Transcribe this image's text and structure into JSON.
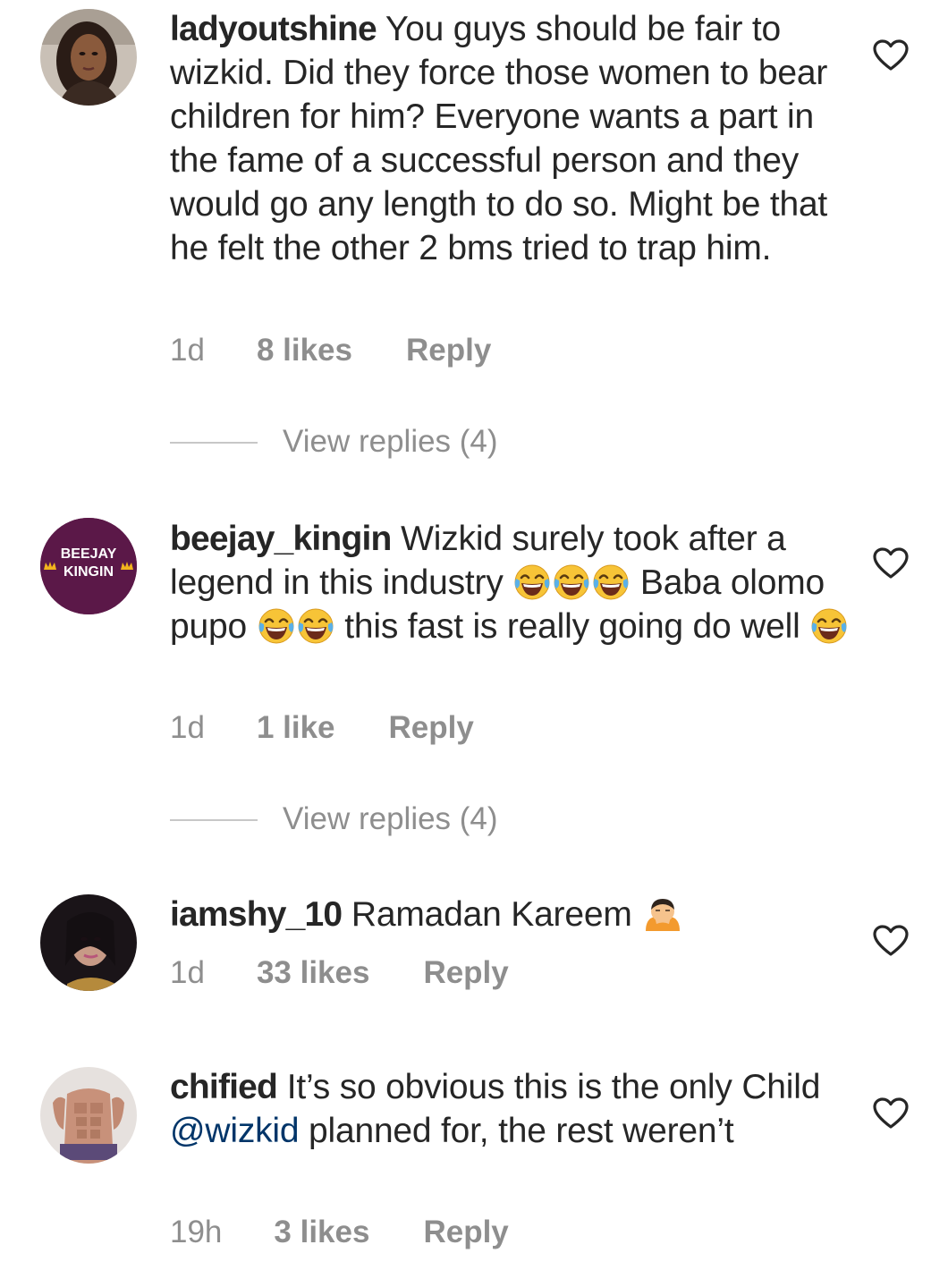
{
  "comments": [
    {
      "username": "ladyoutshine",
      "text": " You guys should be fair to wizkid. Did they force those women to bear children for him? Everyone wants a part in the fame of a successful person and they would go any length to do so. Might be that he felt the other 2 bms tried to trap him.",
      "time": "1d",
      "likes": "8 likes",
      "reply": "Reply",
      "view_replies": "View replies (4)",
      "like_icon": "heart-outline-icon"
    },
    {
      "username": "beejay_kingin",
      "text_1": " Wizkid surely took after a legend in this industry ",
      "emoji_1": "face-with-tears-of-joy",
      "text_2": " Baba olomo pupo ",
      "text_3": " this fast is really going do well ",
      "avatar_line1": "BEEJAY",
      "avatar_line2": "KINGIN",
      "time": "1d",
      "likes": "1 like",
      "reply": "Reply",
      "view_replies": "View replies (4)",
      "like_icon": "heart-outline-icon"
    },
    {
      "username": "iamshy_10",
      "text": " Ramadan Kareem ",
      "emoji": "person-bowing",
      "time": "1d",
      "likes": "33 likes",
      "reply": "Reply",
      "like_icon": "heart-outline-icon"
    },
    {
      "username": "chified",
      "text_1": " It’s so obvious this is the only Child ",
      "mention": "@wizkid",
      "text_2": " planned for, the rest weren’t",
      "time": "19h",
      "likes": "3 likes",
      "reply": "Reply",
      "like_icon": "heart-outline-icon"
    }
  ],
  "colors": {
    "text": "#262626",
    "secondary": "#8e8e8e",
    "mention": "#003569",
    "avatar_beejay": "#5b1848"
  }
}
